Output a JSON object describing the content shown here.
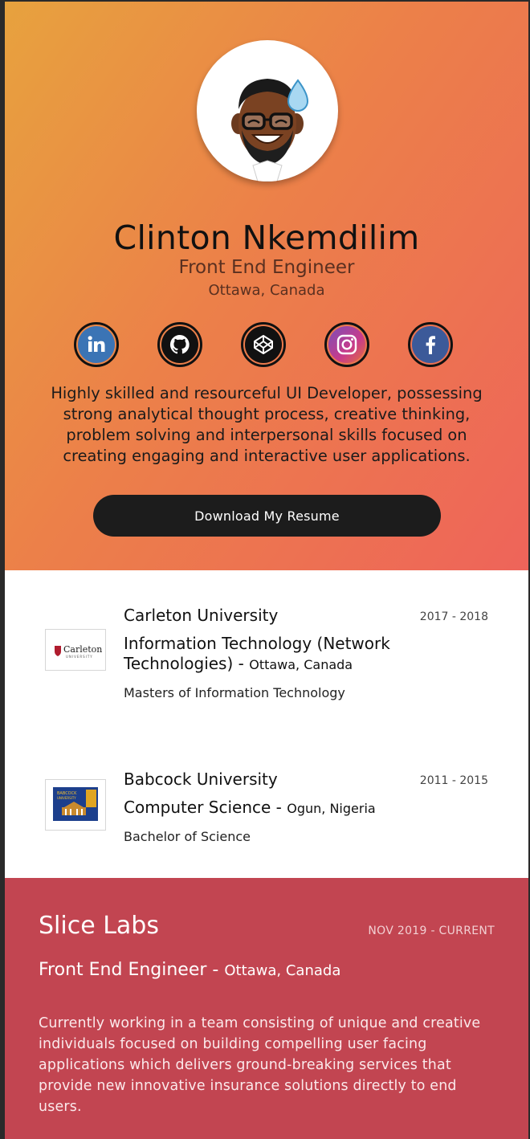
{
  "profile": {
    "name": "Clinton Nkemdilim",
    "title": "Front End Engineer",
    "location": "Ottawa, Canada",
    "avatar_icon": "memoji-avatar",
    "bio": "Highly skilled and resourceful UI Developer, possessing strong analytical thought process, creative thinking, problem solving and interpersonal skills focused on creating engaging and interactive user applications.",
    "download_label": "Download My Resume"
  },
  "socials": [
    {
      "name": "linkedin",
      "label": "in",
      "color": "#3b74b5"
    },
    {
      "name": "github",
      "color": "#111111"
    },
    {
      "name": "codepen",
      "color": "#111111"
    },
    {
      "name": "instagram",
      "color": "#9b3ea0"
    },
    {
      "name": "facebook",
      "color": "#3c5a99"
    }
  ],
  "education": [
    {
      "school": "Carleton University",
      "years": "2017 - 2018",
      "program": "Information Technology (Network Technologies)",
      "separator": " - ",
      "location": "Ottawa, Canada",
      "credential": "Masters of Information Technology",
      "logo_text": "Carleton",
      "logo_subtext": "UNIVERSITY"
    },
    {
      "school": "Babcock University",
      "years": "2011 - 2015",
      "program": "Computer Science",
      "separator": " - ",
      "location": "Ogun, Nigeria",
      "credential": "Bachelor of Science",
      "logo_text": "BABCOCK",
      "logo_subtext": "UNIVERSITY"
    }
  ],
  "work": {
    "company": "Slice Labs",
    "period": "NOV 2019 - CURRENT",
    "role": "Front End Engineer",
    "separator": " - ",
    "location": "Ottawa, Canada",
    "description": "Currently working in a team consisting of unique and creative individuals focused on building compelling user facing applications which delivers ground-breaking services that provide new innovative insurance solutions directly to end users."
  },
  "colors": {
    "hero_gradient_start": "#e7a23e",
    "hero_gradient_end": "#ee645a",
    "work_background": "#c24551",
    "button_background": "#1c1c1c"
  }
}
